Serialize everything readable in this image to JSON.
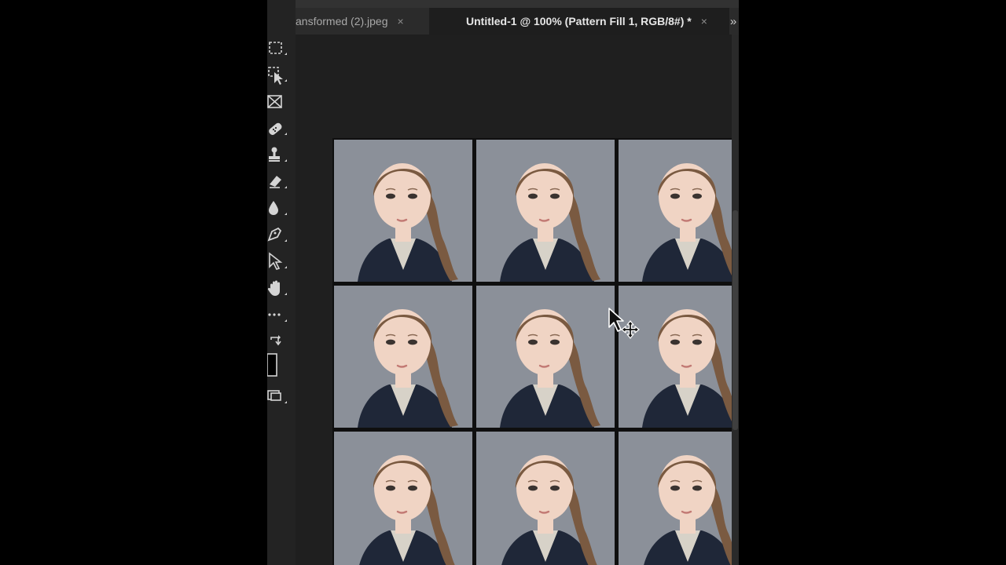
{
  "tabs": [
    {
      "label": "ansformed (2).jpeg",
      "close": "×",
      "active": false
    },
    {
      "label": "Untitled-1 @ 100% (Pattern Fill 1, RGB/8#) *",
      "close": "×",
      "active": true
    }
  ],
  "tabbar": {
    "overflow": "»"
  },
  "toolbar": {
    "tools": [
      "rectangular-marquee",
      "object-selection",
      "frame",
      "spot-healing-brush",
      "clone-stamp",
      "eraser",
      "blur",
      "pen",
      "path-selection",
      "hand",
      "more-tools",
      "swap-colors",
      "color-swatch",
      "screen-mode"
    ]
  },
  "colors": {
    "app_bg": "#232323",
    "canvas_bg": "#1f1f1f",
    "tab_active": "#1e1e1e",
    "photo_bg": "#8b9099",
    "jacket": "#1f2738",
    "hair": "#7a5a41",
    "skin": "#f0d4c4"
  },
  "document": {
    "grid_rows": 3,
    "grid_cols": 3,
    "content": "passport-photo-grid"
  }
}
